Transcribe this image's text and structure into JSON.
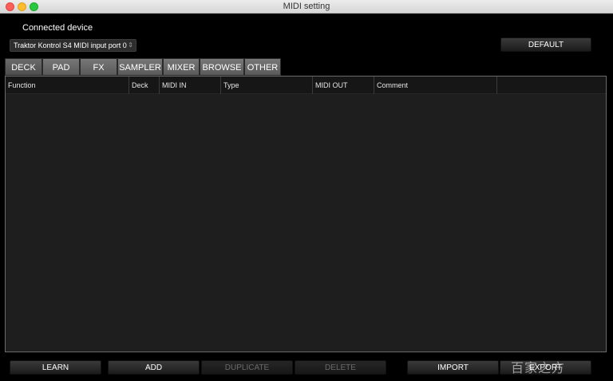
{
  "window": {
    "title": "MIDI setting"
  },
  "device": {
    "section_label": "Connected device",
    "selected": "Traktor Kontrol S4 MIDI input port 0",
    "arrows": "⇕"
  },
  "buttons": {
    "default": "DEFAULT"
  },
  "tabs": [
    "DECK",
    "PAD",
    "FX",
    "SAMPLER",
    "MIXER",
    "BROWSE",
    "OTHER"
  ],
  "table": {
    "columns": [
      "Function",
      "Deck",
      "MIDI IN",
      "Type",
      "MIDI OUT",
      "Comment",
      ""
    ],
    "rows": []
  },
  "bottom_buttons": [
    {
      "label": "LEARN",
      "enabled": true
    },
    {
      "label": "ADD",
      "enabled": true
    },
    {
      "label": "DUPLICATE",
      "enabled": false
    },
    {
      "label": "DELETE",
      "enabled": false
    },
    {
      "label": "IMPORT",
      "enabled": true
    },
    {
      "label": "EXPORT",
      "enabled": true
    }
  ],
  "watermark": "百家之方"
}
